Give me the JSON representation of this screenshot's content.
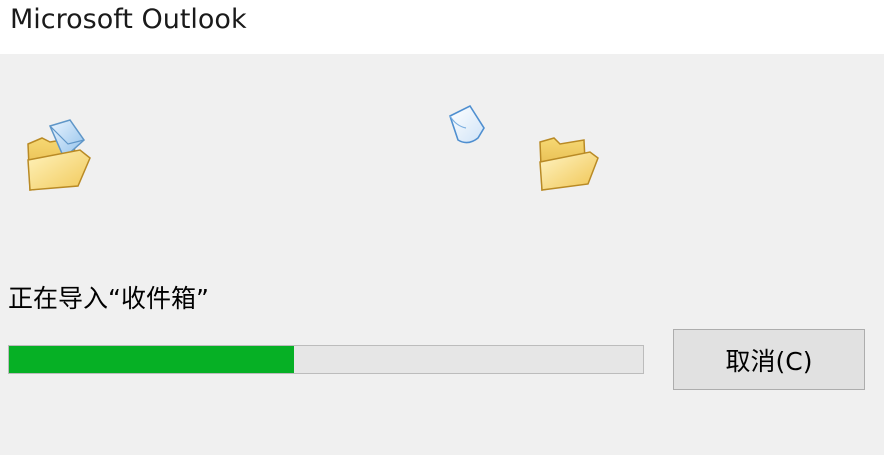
{
  "window": {
    "title": "Microsoft Outlook"
  },
  "status": {
    "text": "正在导入“收件箱”"
  },
  "progress": {
    "value_percent": 45,
    "fill_color": "#06b025"
  },
  "buttons": {
    "cancel_label": "取消(C)"
  },
  "icons": {
    "source": "open-folder-with-mail-icon",
    "flying": "flying-document-icon",
    "destination": "open-folder-icon"
  }
}
